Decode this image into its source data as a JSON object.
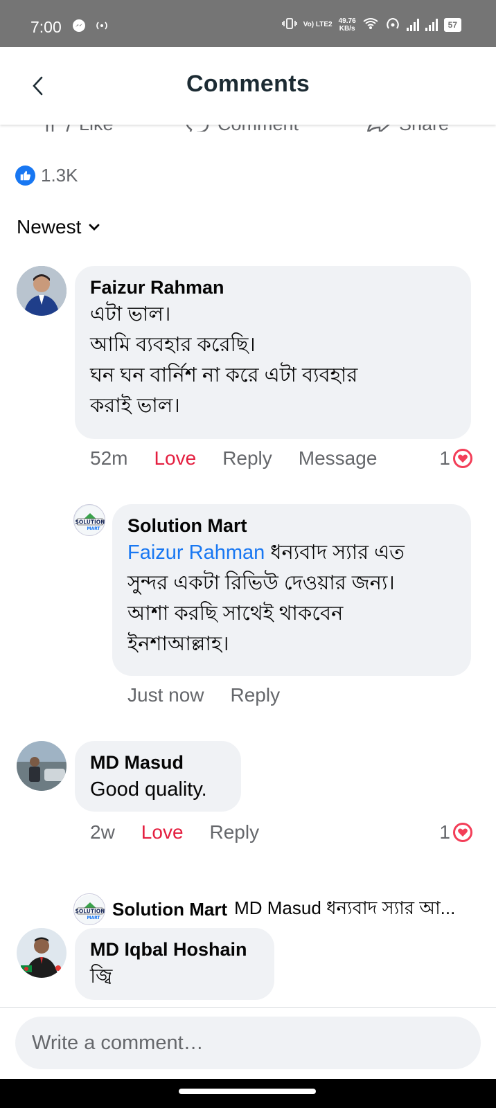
{
  "status_bar": {
    "time": "7:00",
    "network_label_top": "Vo) LTE2",
    "speed_value": "49.76",
    "speed_unit": "KB/s",
    "battery": "57"
  },
  "header": {
    "title": "Comments"
  },
  "actions": {
    "like": "Like",
    "comment": "Comment",
    "share": "Share"
  },
  "reactions": {
    "count": "1.3K"
  },
  "sort": {
    "label": "Newest"
  },
  "comments": [
    {
      "author": "Faizur Rahman",
      "lines": [
        "এটা ভাল।",
        "আমি ব্যবহার করেছি।",
        "ঘন ঘন বার্নিশ না করে এটা ব্যবহার",
        "করাই ভাল।"
      ],
      "time": "52m",
      "love": "Love",
      "reply": "Reply",
      "message": "Message",
      "reaction_count": "1"
    },
    {
      "author": "Solution Mart",
      "mention": "Faizur Rahman",
      "first_line_rest": " ধন্যবাদ স্যার এত",
      "lines": [
        "সুন্দর একটা রিভিউ দেওয়ার জন্য।",
        "আশা করছি সাথেই থাকবেন",
        "ইনশাআল্লাহ।"
      ],
      "time": "Just now",
      "reply": "Reply"
    },
    {
      "author": "MD Masud",
      "text": "Good quality.",
      "time": "2w",
      "love": "Love",
      "reply": "Reply",
      "reaction_count": "1"
    },
    {
      "author": "Solution Mart",
      "text": "MD Masud ধন্যবাদ স্যার আ..."
    },
    {
      "author": "MD Iqbal Hoshain",
      "text": "জ্বি"
    }
  ],
  "composer": {
    "placeholder": "Write a comment…"
  },
  "colors": {
    "love": "#e41e3f",
    "link": "#1877f2",
    "bubble": "#f0f2f5",
    "meta": "#65676b"
  }
}
